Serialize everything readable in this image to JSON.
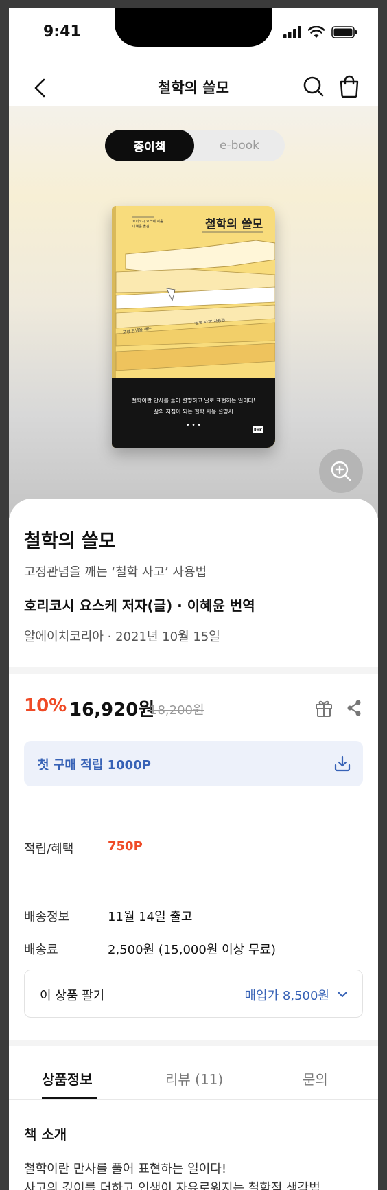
{
  "status": {
    "time": "9:41"
  },
  "nav": {
    "title": "철학의 쓸모"
  },
  "format_toggle": {
    "selected": "종이책",
    "other": "e-book"
  },
  "book": {
    "cover_title": "철학의 쓸모",
    "cover_author_lines": [
      "호리코시 요스케 지음",
      "이혜윤 옮김"
    ],
    "cover_tagline_left": "고정 관념을 깨는",
    "cover_tagline_right": "'철학 사고' 사용법",
    "cover_band_line1": "철학이란 만사를 풀어 설명하고 말로 표현하는 일이다!",
    "cover_band_line2": "삶의 지침이 되는 철학 사용 설명서",
    "cover_band_dots": "• • •",
    "cover_publisher_mark": "RHK",
    "title": "철학의 쓸모",
    "subtitle": "고정관념을 깨는 ‘철학 사고’ 사용법",
    "authors": "호리코시 요스케 저자(글) · 이혜윤 번역",
    "publisher_date": "알에이치코리아 · 2021년 10월 15일"
  },
  "price": {
    "discount": "10%",
    "sale": "16,920원",
    "original": "18,200원"
  },
  "coupon": {
    "label": "첫 구매 적립 1000P"
  },
  "benefits": {
    "label": "적립/혜택",
    "value": "750P"
  },
  "delivery": {
    "info_label": "배송정보",
    "info_value": "11월 14일 출고",
    "fee_label": "배송료",
    "fee_value": "2,500원 (15,000원 이상 무료)"
  },
  "sell": {
    "label": "이 상품 팔기",
    "price": "매입가 8,500원"
  },
  "tabs": [
    {
      "label": "상품정보",
      "active": true
    },
    {
      "label": "리뷰 (11)",
      "active": false
    },
    {
      "label": "문의",
      "active": false
    }
  ],
  "intro": {
    "title": "책 소개",
    "lines": [
      "철학이란 만사를 풀어 표현하는 일이다!",
      "사고의 깊이를 더하고 인생이 자유로워지는 철학적 생각법"
    ]
  },
  "colors": {
    "accent": "#ef4a26",
    "link": "#3762b6",
    "cover_yellow": "#f8dc7c"
  }
}
